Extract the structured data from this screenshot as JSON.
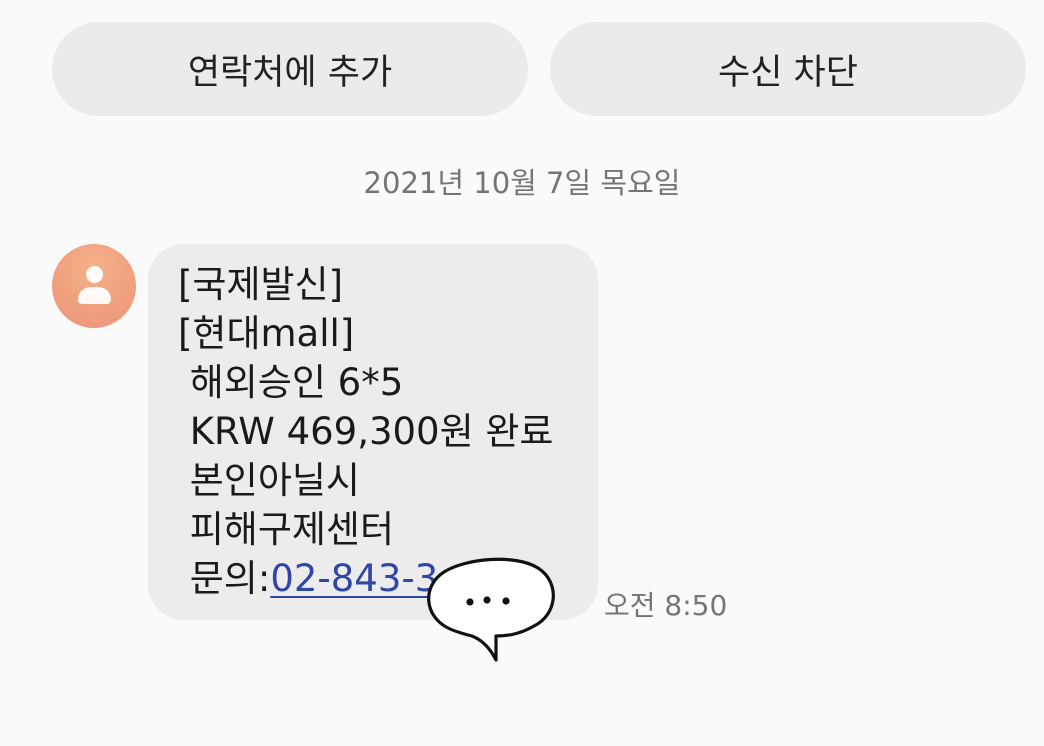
{
  "top_actions": {
    "add_contact_label": "연락처에 추가",
    "block_label": "수신 차단"
  },
  "conversation": {
    "date_separator": "2021년 10월 7일 목요일",
    "message": {
      "lines": [
        "[국제발신]",
        "[현대mall]",
        " 해외승인 6*5",
        " KRW 469,300원 완료",
        " 본인아닐시",
        " 피해구제센터"
      ],
      "last_line_prefix": " 문의:",
      "phone_link": "02-843-3",
      "time": "오전 8:50"
    },
    "sender_avatar_color": "#f0a07e",
    "link_color": "#2f45a8"
  }
}
